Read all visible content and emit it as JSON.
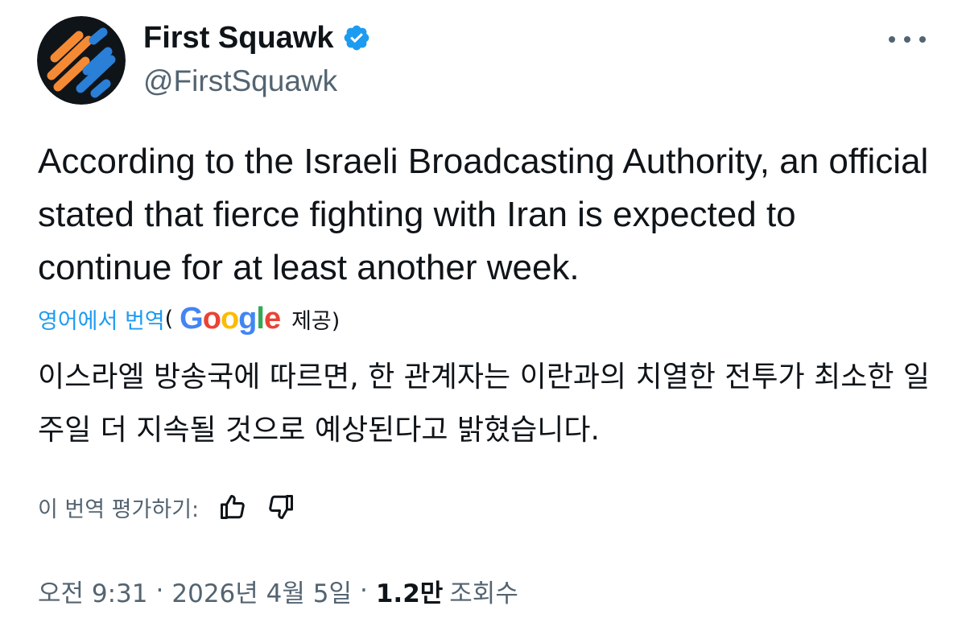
{
  "author": {
    "display_name": "First Squawk",
    "handle": "@FirstSquawk",
    "verified": true,
    "avatar_icon": "first-squawk-logo",
    "verified_color": "#1d9bf0"
  },
  "menu": {
    "more_icon": "more-dots-icon"
  },
  "tweet": {
    "text": "According to the Israeli Broadcasting Authority, an official stated that fierce fighting with Iran is expected to continue for at least another week."
  },
  "translation": {
    "link_label": "영어에서 번역",
    "open_paren": "(",
    "provider_letters": [
      "G",
      "o",
      "o",
      "g",
      "l",
      "e"
    ],
    "provided_label": "제공)",
    "text": "이스라엘 방송국에 따르면, 한 관계자는 이란과의 치열한 전투가 최소한 일주일 더 지속될 것으로 예상된다고 밝혔습니다.",
    "rate_label": "이 번역 평가하기:",
    "thumbs_up_icon": "thumbs-up-icon",
    "thumbs_down_icon": "thumbs-down-icon"
  },
  "meta": {
    "time": "오전 9:31",
    "separator": "·",
    "date": "2026년 4월 5일",
    "views_count": "1.2만",
    "views_label": "조회수"
  },
  "colors": {
    "text_primary": "#0f1419",
    "text_secondary": "#536471",
    "link": "#1d9bf0",
    "avatar_orange": "#f58a34",
    "avatar_blue": "#2a7fd6"
  }
}
